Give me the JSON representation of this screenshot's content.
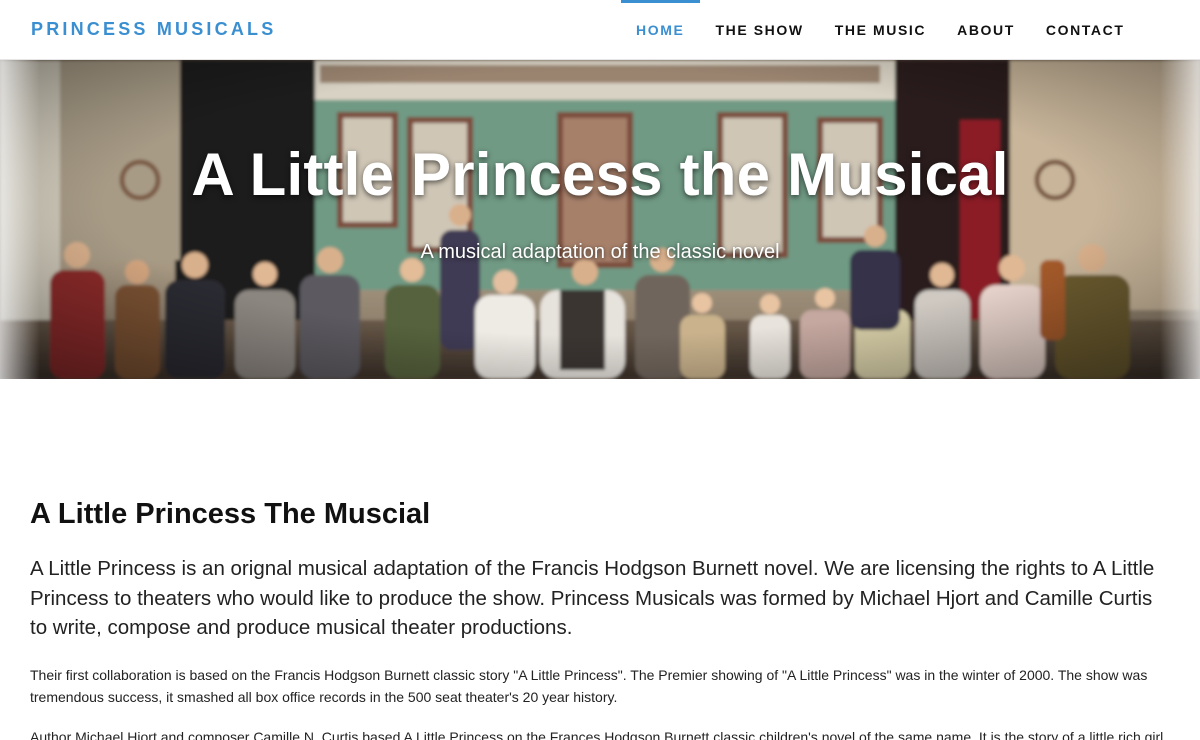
{
  "nav": {
    "brand": "PRINCESS MUSICALS",
    "items": [
      {
        "label": "HOME",
        "active": true
      },
      {
        "label": "THE SHOW",
        "active": false
      },
      {
        "label": "THE MUSIC",
        "active": false
      },
      {
        "label": "ABOUT",
        "active": false
      },
      {
        "label": "CONTACT",
        "active": false
      }
    ],
    "accent_color": "#3a8fd1"
  },
  "hero": {
    "title": "A Little Princess the Musical",
    "subtitle": "A musical adaptation of the classic novel"
  },
  "main": {
    "heading": "A Little Princess The Muscial",
    "lead": "A Little Princess is an orignal musical adaptation of the Francis Hodgson Burnett novel. We are licensing the rights to A Little Princess to theaters who would like to produce the show. Princess Musicals was formed by Michael Hjort and Camille Curtis to write, compose and produce musical theater productions.",
    "paragraph1": "Their first collaboration is based on the Francis Hodgson Burnett classic story \"A Little Princess\". The Premier showing of \"A Little Princess\" was in the winter of 2000. The show was tremendous success, it smashed all box office records in the 500 seat theater's 20 year history.",
    "paragraph2": "Author Michael Hjort and composer Camille N. Curtis based A Little Princess on the Frances Hodgson Burnett classic children's novel of the same name. It is the story of a little rich girl"
  }
}
